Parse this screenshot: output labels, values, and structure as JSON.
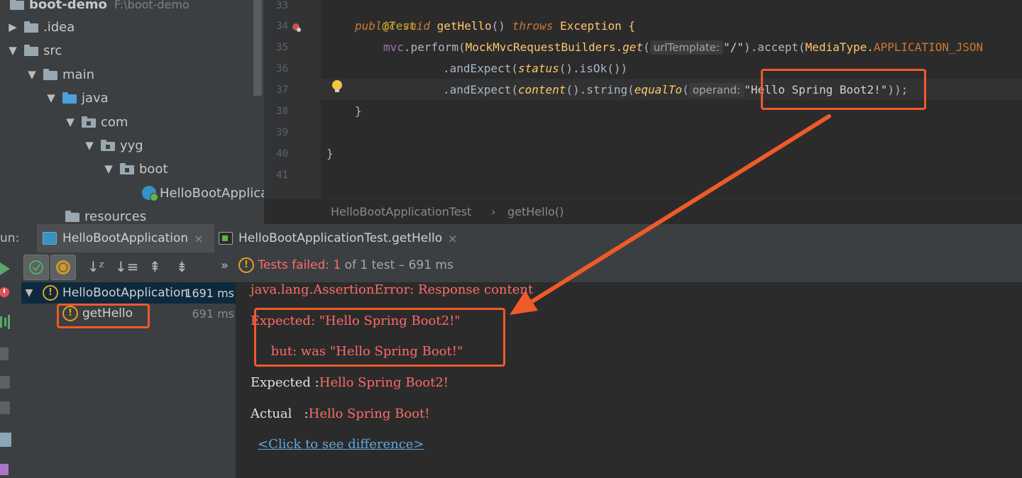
{
  "project": {
    "root_name": "boot-demo",
    "root_path": "F:\\boot-demo",
    "items": [
      {
        "label": "boot-demo",
        "expanded": true
      },
      {
        "label": ".idea",
        "expanded": false
      },
      {
        "label": "src",
        "expanded": true
      },
      {
        "label": "main",
        "expanded": true
      },
      {
        "label": "java",
        "expanded": true
      },
      {
        "label": "com",
        "expanded": true
      },
      {
        "label": "yyg",
        "expanded": true
      },
      {
        "label": "boot",
        "expanded": true
      },
      {
        "label": "HelloBootApplicat"
      },
      {
        "label": "resources"
      }
    ]
  },
  "editor": {
    "line_numbers": [
      "33",
      "34",
      "35",
      "36",
      "37",
      "38",
      "39",
      "40",
      "41"
    ],
    "lines": {
      "l33_annotation": "@Test",
      "l34_public": "public",
      "l34_void": "void",
      "l34_method": "getHello",
      "l34_parens": "() ",
      "l34_throws": "throws",
      "l34_exception": "Exception {",
      "l35_mvc": "mvc",
      "l35_dot_perform": ".perform(",
      "l35_builders": "MockMvcRequestBuilders.",
      "l35_get": "get",
      "l35_paren": "(",
      "l35_hint": "urlTemplate:",
      "l35_url": "\"/\"",
      "l35_accept": ").accept(",
      "l35_mediatype": "MediaType.",
      "l35_json": "APPLICATION_JSON",
      "l36_expect": ".andExpect(",
      "l36_status": "status",
      "l36_rest": "().isOk())",
      "l37_expect": ".andExpect(",
      "l37_content": "content",
      "l37_string": "().string(",
      "l37_equalto": "equalTo",
      "l37_paren": "(",
      "l37_hint": "operand:",
      "l37_value": "\"Hello Spring Boot2!\"",
      "l37_end": "));",
      "l38_brace": "}",
      "l40_brace": "}"
    },
    "breadcrumb": [
      "HelloBootApplicationTest",
      "getHello()"
    ],
    "breadcrumb_sep": "›"
  },
  "run_bar": {
    "label": "un:",
    "tabs": [
      {
        "label": "HelloBootApplication",
        "active": true
      },
      {
        "label": "HelloBootApplicationTest.getHello",
        "active": false
      }
    ],
    "close_glyph": "×"
  },
  "toolbar": {
    "more_glyph": "»",
    "status_prefix": "Tests failed: ",
    "status_failed": "1",
    "status_rest": " of 1 test – 691 ms",
    "status_color": "#ff6b68"
  },
  "test_tree": {
    "root": {
      "label": "HelloBootApplication",
      "time": "1691 ms"
    },
    "child": {
      "label": "getHello",
      "time": "691 ms"
    }
  },
  "console": {
    "error_line": "java.lang.AssertionError: Response content",
    "expected_line": "Expected: \"Hello Spring Boot2!\"",
    "but_line": "     but: was \"Hello Spring Boot!\"",
    "expected_label": "Expected :",
    "expected_value": "Hello Spring Boot2!",
    "actual_label": "Actual   :",
    "actual_value": "Hello Spring Boot!",
    "diff_link": "<Click to see difference>"
  },
  "colors": {
    "annotation_red": "#ef5a2a",
    "error_red": "#ff6b68",
    "warning_orange": "#e3a020"
  }
}
